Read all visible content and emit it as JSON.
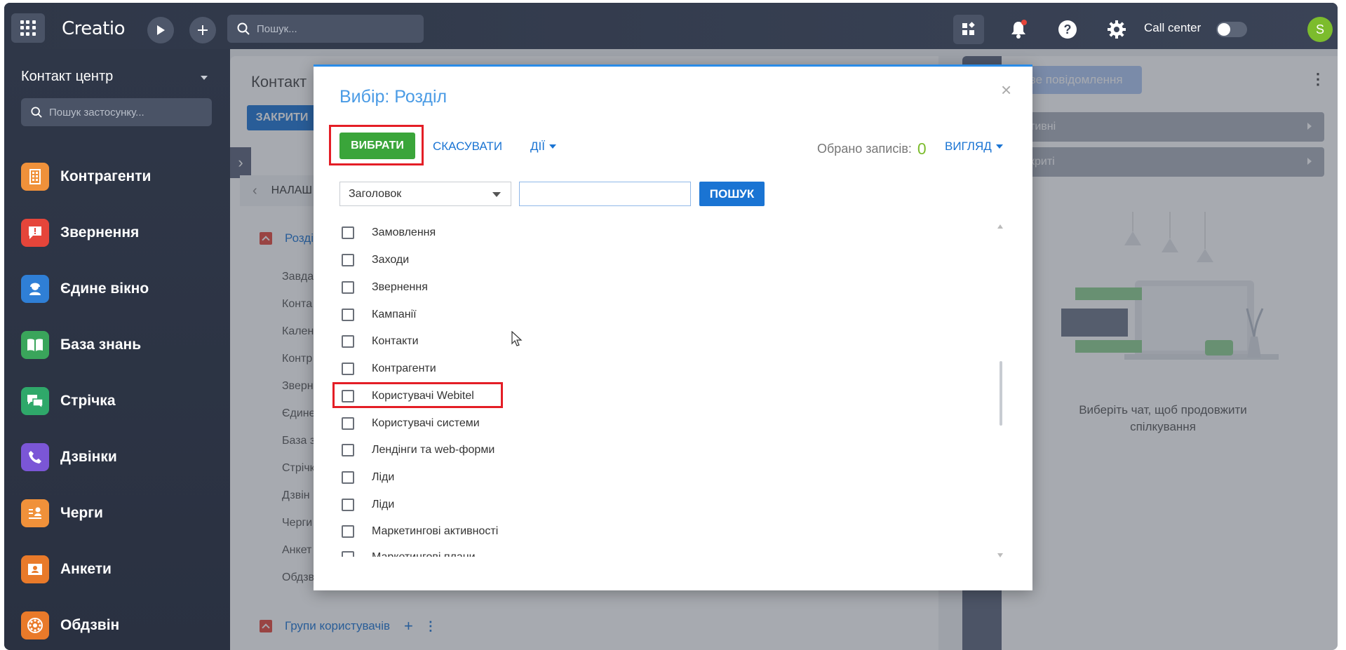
{
  "topbar": {
    "logo": "Creatio",
    "search_placeholder": "Пошук...",
    "call_center_label": "Call center",
    "avatar_letter": "S"
  },
  "sidebar": {
    "title": "Контакт центр",
    "search_placeholder": "Пошук застосунку...",
    "items": [
      {
        "label": "Контрагенти",
        "color": "#f0913a",
        "icon": "building-icon"
      },
      {
        "label": "Звернення",
        "color": "#e5453a",
        "icon": "case-icon"
      },
      {
        "label": "Єдине вікно",
        "color": "#2f7fd6",
        "icon": "agent-icon"
      },
      {
        "label": "База знань",
        "color": "#3aa55b",
        "icon": "book-icon"
      },
      {
        "label": "Стрічка",
        "color": "#2fa86a",
        "icon": "feed-icon"
      },
      {
        "label": "Дзвінки",
        "color": "#7b56d6",
        "icon": "phone-icon"
      },
      {
        "label": "Черги",
        "color": "#f0913a",
        "icon": "queue-icon"
      },
      {
        "label": "Анкети",
        "color": "#e97a2a",
        "icon": "form-icon"
      },
      {
        "label": "Обдзвін",
        "color": "#e97a2a",
        "icon": "dial-icon"
      }
    ]
  },
  "page": {
    "title": "Контакт",
    "close_label": "ЗАКРИТИ",
    "tab_label": "НАЛАШ",
    "section1": "Розді",
    "section2": "Групи користувачів",
    "fragments": [
      "Завда",
      "Конта",
      "Кален",
      "Контр",
      "Зверн",
      "Єдине",
      "База з",
      "Стрічк",
      "Дзвін",
      "Черги",
      "Анкет",
      "Обдзв"
    ]
  },
  "chat": {
    "new_message": "Нове повідомлення",
    "active_label": "тивні",
    "closed_label": "криті",
    "empty_message": "Виберіть чат, щоб продовжити спілкування"
  },
  "modal": {
    "title": "Вибір: Розділ",
    "select_label": "ВИБРАТИ",
    "cancel_label": "СКАСУВАТИ",
    "actions_label": "ДІЇ",
    "selected_label": "Обрано записів:",
    "selected_count": "0",
    "view_label": "ВИГЛЯД",
    "filter_column": "Заголовок",
    "search_label": "ПОШУК",
    "rows": [
      "Замовлення",
      "Заходи",
      "Звернення",
      "Кампанії",
      "Контакти",
      "Контрагенти",
      "Користувачі Webitel",
      "Користувачі системи",
      "Лендінги та web-форми",
      "Ліди",
      "Ліди",
      "Маркетингові активності",
      "Маркетингові плани"
    ]
  }
}
